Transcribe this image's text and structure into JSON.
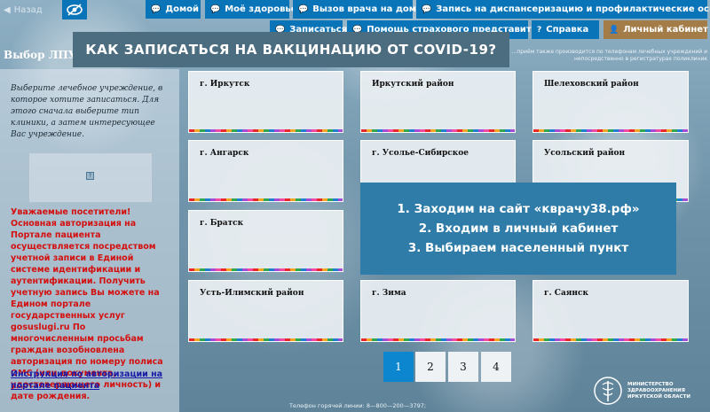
{
  "nav": {
    "back_label": "Назад",
    "home": "Домой",
    "health": "Моё здоровье",
    "doctor_home": "Вызов врача на дом",
    "checkup": "Запись на диспансеризацию и профилактические осмотры",
    "signup": "Записаться",
    "insurance_help": "Помощь страхового представителя",
    "help": "Справка",
    "cabinet": "Личный кабинет"
  },
  "banner": {
    "title": "КАК ЗАПИСАТЬСЯ НА ВАКЦИНАЦИЮ ОТ COVID-19?",
    "note": "...приём также производится по телефонам лечебных учреждений и непосредственно в регистратурах поликлиник"
  },
  "left": {
    "title": "Выбор ЛПУ",
    "intro": "Выберите лечебное учреждение, в которое хотите записаться. Для этого сначала выберите тип клиники, а затем интересующее Вас учреждение.",
    "notice": "Уважаемые посетители! Основная авторизация на Портале пациента осуществляется посредством учетной записи в Единой системе идентификации и аутентификации. Получить учетную запись Вы можете на Едином портале государственных услуг gosuslugi.ru По многочисленным просьбам граждан возобновлена авторизация по номеру полиса ОМС (или документа, удостоверяющего личность) и дате рождения.",
    "link": "Инструкция по авторизации на портале пациента"
  },
  "tiles": [
    "г. Иркутск",
    "Иркутский район",
    "Шелеховский район",
    "г. Ангарск",
    "г. Усолье-Сибирское",
    "Усольский район",
    "г. Братск",
    "Усть-Илимский район",
    "г. Зима",
    "г. Саянск"
  ],
  "overlay": {
    "line1": "1. Заходим на сайт «квpачу38.рф»",
    "line2": "2. Входим в личный кабинет",
    "line3": "3. Выбираем населенный пункт"
  },
  "pagination": {
    "p1": "1",
    "p2": "2",
    "p3": "3",
    "p4": "4",
    "active": 1
  },
  "footer": {
    "hotline": "Телефон горячей линии: 8—800—200—3797;",
    "ministry_l1": "МИНИСТЕРСТВО",
    "ministry_l2": "ЗДРАВООХРАНЕНИЯ",
    "ministry_l3": "ИРКУТСКОЙ ОБЛАСТИ"
  }
}
